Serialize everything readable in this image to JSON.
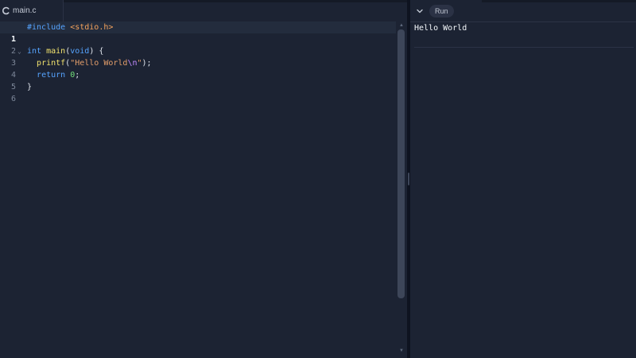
{
  "editor": {
    "tab": {
      "filename": "main.c",
      "icon": "c-language-icon"
    },
    "lines": [
      {
        "number": "1"
      },
      {
        "number": "2"
      },
      {
        "number": "3",
        "fold": "⌄"
      },
      {
        "number": "4"
      },
      {
        "number": "5"
      },
      {
        "number": "6"
      }
    ],
    "code": {
      "l1_macro": "#include",
      "l1_path": "<stdio.h>",
      "l3_type": "int",
      "l3_func": "main",
      "l3_open": "(",
      "l3_void": "void",
      "l3_close": ") {",
      "l4_func": "printf",
      "l4_open": "(",
      "l4_str_a": "\"Hello World",
      "l4_escape": "\\n",
      "l4_str_b": "\"",
      "l4_close": ");",
      "l5_kw": "return",
      "l5_num": "0",
      "l5_semi": ";",
      "l6_brace": "}"
    }
  },
  "console": {
    "collapse_icon": "chevron-down-icon",
    "run_label": "Run",
    "output": "Hello World"
  },
  "colors": {
    "background": "#1c2333",
    "keyword": "#56a4ff",
    "function": "#f2e36e",
    "string": "#e29d6a",
    "number": "#73e07a",
    "escape": "#c28bff"
  }
}
